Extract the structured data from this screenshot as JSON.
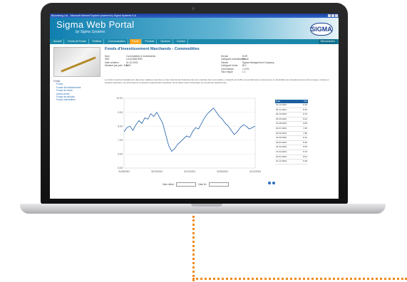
{
  "browser": {
    "title": "Bloomberg Ltd. - Microsoft Internet Explorer powered by Sigma Systems S.A."
  },
  "portal": {
    "title": "Sigma Web Portal",
    "subtitle": "by Sigma Systems",
    "logo_text": "SIGMA"
  },
  "nav": {
    "items": [
      "Accueil",
      "Fonds de Funds",
      "Portfolio",
      "Communication",
      "Funds",
      "Produits",
      "Services",
      "Contact"
    ],
    "active_index": 4,
    "right_label": "Déconnexion"
  },
  "fund": {
    "title": "Fonds d'Investissement Marchands - Commodities",
    "info_left": [
      {
        "key": "Nom",
        "value": "Commodities & Investments"
      },
      {
        "key": "ISIN",
        "value": "LU1234567890"
      },
      {
        "key": "Date création",
        "value": "01.02.2002"
      },
      {
        "key": "Montant par part / NAV",
        "value": "8.20"
      }
    ],
    "info_right": [
      {
        "key": "Devise",
        "value": "EUR"
      },
      {
        "key": "Catégorie investisseurs",
        "value": "Retail"
      },
      {
        "key": "Gérant",
        "value": "Sigma Management Company"
      },
      {
        "key": "Catégorie fonds",
        "value": "BCI"
      },
      {
        "key": "Commission",
        "value": "1.10%"
      },
      {
        "key": "Taux risque",
        "value": "1.1"
      }
    ],
    "description": "Le fonds investit principalement dans des matières premières et des instruments financiers liés aux marchés des commodités. L'objectif est d'offrir une performance à long terme en diversifiant les investissements entre énergie, métaux et produits agricoles. Les informations ci-dessous représentent l'évolution de la valeur nette d'inventaire sur la période sélectionnée."
  },
  "sidebar": {
    "root": "Fonds",
    "items": [
      "Fonds",
      "Fonds d'investissement",
      "Fonds de fonds",
      "Autres fonds",
      "Fonds de pension",
      "Fonds immobiliers"
    ]
  },
  "chart_data": {
    "type": "line",
    "title": "",
    "xlabel": "",
    "ylabel": "",
    "x_ticks": [
      "31/08/2002",
      "31/03/2003",
      "31/10/2003",
      "31/05/2004",
      "31/12/2004"
    ],
    "y_ticks": [
      "5.00",
      "6.00",
      "7.00",
      "8.00",
      "9.00",
      "10.00"
    ],
    "ylim": [
      5,
      10
    ],
    "series": [
      {
        "values": [
          7.6,
          7.9,
          8.0,
          7.7,
          8.1,
          8.4,
          8.2,
          8.6,
          8.5,
          8.9,
          8.7,
          9.0,
          8.6,
          8.2,
          7.4,
          6.6,
          6.2,
          6.4,
          6.7,
          6.9,
          7.1,
          7.3,
          7.2,
          7.6,
          7.9,
          7.8,
          8.2,
          8.6,
          8.9,
          9.1,
          9.3,
          9.0,
          8.7,
          8.5,
          8.2,
          8.0,
          7.7,
          7.4,
          7.6,
          7.9,
          8.1,
          8.0,
          7.8,
          7.9,
          8.0
        ]
      }
    ]
  },
  "table": {
    "headers": [
      "Date",
      "VNI"
    ],
    "rows": [
      [
        "31.12.2004",
        "8.20"
      ],
      [
        "30.11.2004",
        "8.35"
      ],
      [
        "29.10.2004",
        "8.10"
      ],
      [
        "30.09.2004",
        "8.42"
      ],
      [
        "31.08.2004",
        "8.05"
      ],
      [
        "30.07.2004",
        "7.95"
      ],
      [
        "30.06.2004",
        "7.80"
      ],
      [
        "31.05.2004",
        "8.12"
      ],
      [
        "30.04.2004",
        "8.30"
      ],
      [
        "31.03.2004",
        "8.55"
      ],
      [
        "27.02.2004",
        "8.70"
      ],
      [
        "30.01.2004",
        "8.61"
      ],
      [
        "31.12.2003",
        "8.48"
      ]
    ]
  },
  "date_filter": {
    "from_label": "Date début",
    "to_label": "Date fin"
  }
}
